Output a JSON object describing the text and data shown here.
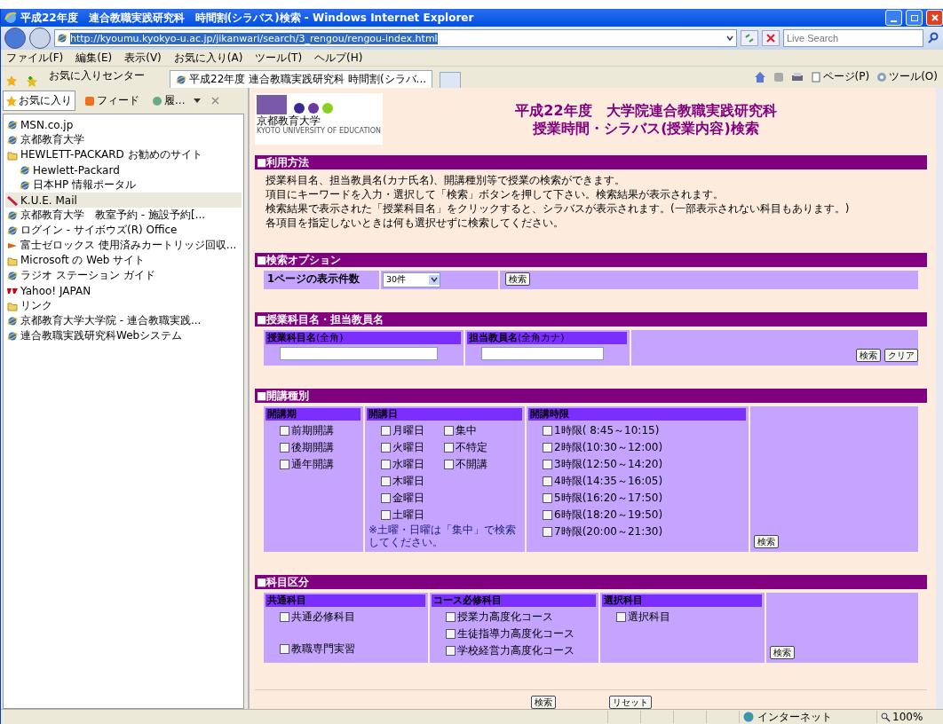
{
  "window": {
    "title": "平成22年度　連合教職実践研究科　時間割(シラバス)検索 - Windows Internet Explorer"
  },
  "address_bar": {
    "url": "http://kyoumu.kyokyo-u.ac.jp/jikanwari/search/3_rengou/rengou-index.html"
  },
  "search_box": {
    "placeholder": "Live Search"
  },
  "menu": [
    "ファイル(F)",
    "編集(E)",
    "表示(V)",
    "お気に入り(A)",
    "ツール(T)",
    "ヘルプ(H)"
  ],
  "favorites_center": {
    "label": "お気に入りセンター"
  },
  "tabs": [
    {
      "label": "平成22年度 連合教職実践研究科 時間割(シラバ...",
      "selected": true
    }
  ],
  "command_bar": [
    "ページ(P)",
    "ツール(O)"
  ],
  "sidebar": {
    "tabs": [
      {
        "label": "お気に入り",
        "kind": "star",
        "selected": true
      },
      {
        "label": "フィード",
        "kind": "feed",
        "selected": false
      },
      {
        "label": "履...",
        "kind": "history",
        "selected": false
      }
    ],
    "items": [
      {
        "label": "MSN.co.jp",
        "kind": "page",
        "selected": false
      },
      {
        "label": "京都教育大学",
        "kind": "page",
        "selected": false
      },
      {
        "label": "HEWLETT-PACKARD お勧めのサイト",
        "kind": "folder",
        "selected": false,
        "children": [
          {
            "label": "Hewlett-Packard",
            "kind": "page",
            "selected": false
          },
          {
            "label": "日本HP 情報ポータル",
            "kind": "page",
            "selected": false
          }
        ]
      },
      {
        "label": "K.U.E. Mail",
        "kind": "mail",
        "selected": true
      },
      {
        "label": "京都教育大学　教室予約 - 施設予約[...",
        "kind": "page",
        "selected": false
      },
      {
        "label": "ログイン - サイボウズ(R) Office",
        "kind": "page",
        "selected": false
      },
      {
        "label": "富士ゼロックス 使用済みカートリッジ回収...",
        "kind": "cartridge",
        "selected": false
      },
      {
        "label": "Microsoft の Web サイト",
        "kind": "folder",
        "selected": false
      },
      {
        "label": "ラジオ ステーション ガイド",
        "kind": "page",
        "selected": false
      },
      {
        "label": "Yahoo! JAPAN",
        "kind": "yahoo",
        "selected": false
      },
      {
        "label": "リンク",
        "kind": "folder",
        "selected": false
      },
      {
        "label": "京都教育大学大学院 - 連合教職実践...",
        "kind": "page",
        "selected": false
      },
      {
        "label": "連合教職実践研究科Webシステム",
        "kind": "page",
        "selected": false
      }
    ]
  },
  "page": {
    "logo": {
      "name": "京都教育大学",
      "subtitle": "KYOTO UNIVERSITY OF EDUCATION"
    },
    "title": [
      "平成22年度　大学院連合教職実践研究科",
      "授業時間・シラバス(授業内容)検索"
    ],
    "usage": {
      "heading": "■利用方法",
      "lines": [
        "授業科目名、担当教員名(カナ氏名)、開講種別等で授業の検索ができます。",
        "項目にキーワードを入力・選択して「検索」ボタンを押して下さい。検索結果が表示されます。",
        "検索結果で表示された「授業科目名」をクリックすると、シラバスが表示されます。(一部表示されない科目もあります。)",
        "各項目を指定しないときは何も選択せずに検索してください。"
      ]
    },
    "options": {
      "heading": "■検索オプション",
      "label": "1ページの表示件数",
      "per_page": "30件",
      "button": "検索"
    },
    "names": {
      "heading": "■授業科目名・担当教員名",
      "fields": [
        {
          "label": "授業科目名",
          "note": "(全角)"
        },
        {
          "label": "担当教員名",
          "note": "(全角カナ)"
        }
      ],
      "buttons": [
        "検索",
        "クリア"
      ]
    },
    "schedule": {
      "heading": "■開講種別",
      "terms": {
        "label": "開講期",
        "items": [
          {
            "label": "前期開講",
            "checked": false
          },
          {
            "label": "後期開講",
            "checked": false
          },
          {
            "label": "通年開講",
            "checked": false
          }
        ]
      },
      "days": {
        "label": "開講日",
        "columns": [
          [
            {
              "label": "月曜日",
              "checked": false
            },
            {
              "label": "火曜日",
              "checked": false
            },
            {
              "label": "水曜日",
              "checked": false
            },
            {
              "label": "木曜日",
              "checked": false
            },
            {
              "label": "金曜日",
              "checked": false
            },
            {
              "label": "土曜日",
              "checked": false
            }
          ],
          [
            {
              "label": "集中",
              "checked": false
            },
            {
              "label": "不特定",
              "checked": false
            },
            {
              "label": "不開講",
              "checked": false
            }
          ]
        ],
        "note": "※土曜・日曜は「集中」で検索してください。"
      },
      "periods": {
        "label": "開講時限",
        "items": [
          {
            "label": "1時限( 8:45～10:15)",
            "checked": false
          },
          {
            "label": "2時限(10:30～12:00)",
            "checked": false
          },
          {
            "label": "3時限(12:50～14:20)",
            "checked": false
          },
          {
            "label": "4時限(14:35～16:05)",
            "checked": false
          },
          {
            "label": "5時限(16:20～17:50)",
            "checked": false
          },
          {
            "label": "6時限(18:20～19:50)",
            "checked": false
          },
          {
            "label": "7時限(20:00～21:30)",
            "checked": false
          }
        ]
      },
      "button": "検索"
    },
    "category": {
      "heading": "■科目区分",
      "groups": [
        {
          "label": "共通科目",
          "items": [
            {
              "label": "共通必修科目",
              "checked": false
            },
            {
              "label": "教職専門実習",
              "checked": false
            }
          ]
        },
        {
          "label": "コース必修科目",
          "items": [
            {
              "label": "授業力高度化コース",
              "checked": false
            },
            {
              "label": "生徒指導力高度化コース",
              "checked": false
            },
            {
              "label": "学校経営力高度化コース",
              "checked": false
            }
          ]
        },
        {
          "label": "選択科目",
          "items": [
            {
              "label": "選択科目",
              "checked": false
            }
          ]
        }
      ],
      "button": "検索"
    },
    "footer_buttons": [
      "検索",
      "リセット"
    ]
  },
  "status_bar": {
    "zone": "インターネット",
    "zoom": "100%"
  }
}
